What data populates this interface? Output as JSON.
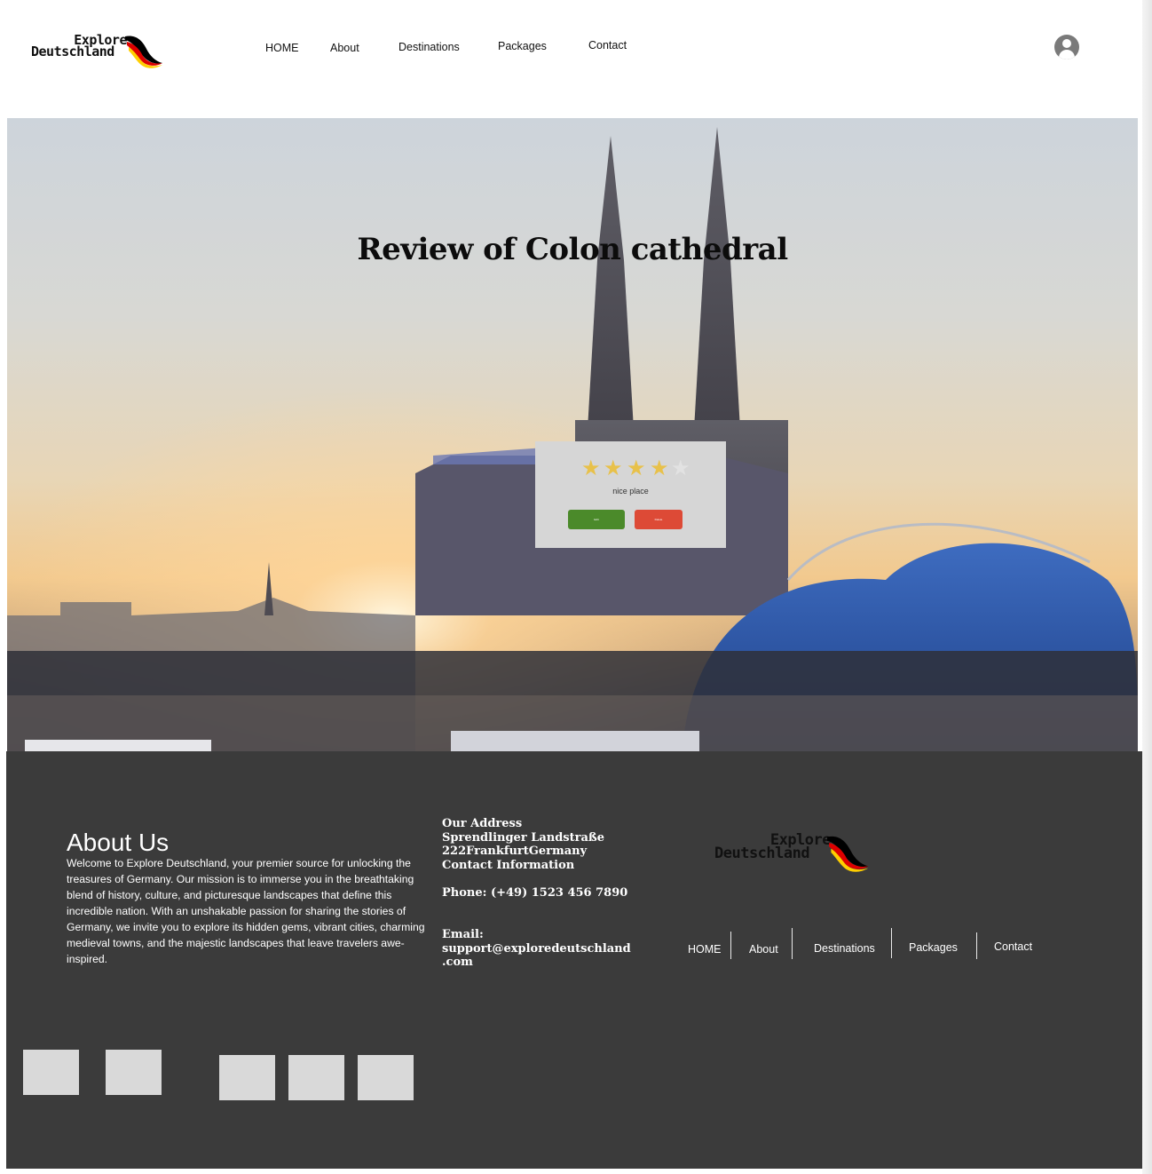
{
  "brand": {
    "line1": "Explore",
    "line2": "Deutschland"
  },
  "nav": {
    "items": [
      {
        "label": "HOME"
      },
      {
        "label": "About"
      },
      {
        "label": "Destinations"
      },
      {
        "label": "Packages"
      },
      {
        "label": "Contact"
      }
    ]
  },
  "hero": {
    "title": "Review of Colon cathedral",
    "review": {
      "rating": 4,
      "max_rating": 5,
      "comment": "nice place",
      "edit_label": "Edit",
      "delete_label": "Delete"
    }
  },
  "footer": {
    "about_title": "About Us",
    "about_text": "Welcome to Explore Deutschland, your premier source for unlocking the treasures of Germany. Our mission is to immerse you in the breathtaking blend of history, culture, and picturesque landscapes that define this incredible nation. With an unshakable passion for sharing the stories of Germany, we invite you to explore its hidden gems, vibrant cities, charming medieval towns, and the majestic landscapes that leave travelers awe-inspired.",
    "address": "Our Address\nSprendlinger Landstraße\n222FrankfurtGermany\nContact Information",
    "phone": "Phone: (+49) 1523 456 7890",
    "email": "Email:\nsupport@exploredeutschland\n.com",
    "nav": [
      "HOME",
      "About",
      "Destinations",
      "Packages",
      "Contact"
    ]
  },
  "colors": {
    "footer_bg": "#3b3b3b",
    "edit_button": "#4b8a2a",
    "delete_button": "#dd4a36",
    "star_on": "#e8c14a",
    "star_off": "#e2e2e2",
    "flag": [
      "#000000",
      "#dd0000",
      "#ffce00"
    ]
  },
  "icons": [
    "user-account-icon",
    "star-icon",
    "german-flag-swoosh-icon"
  ]
}
